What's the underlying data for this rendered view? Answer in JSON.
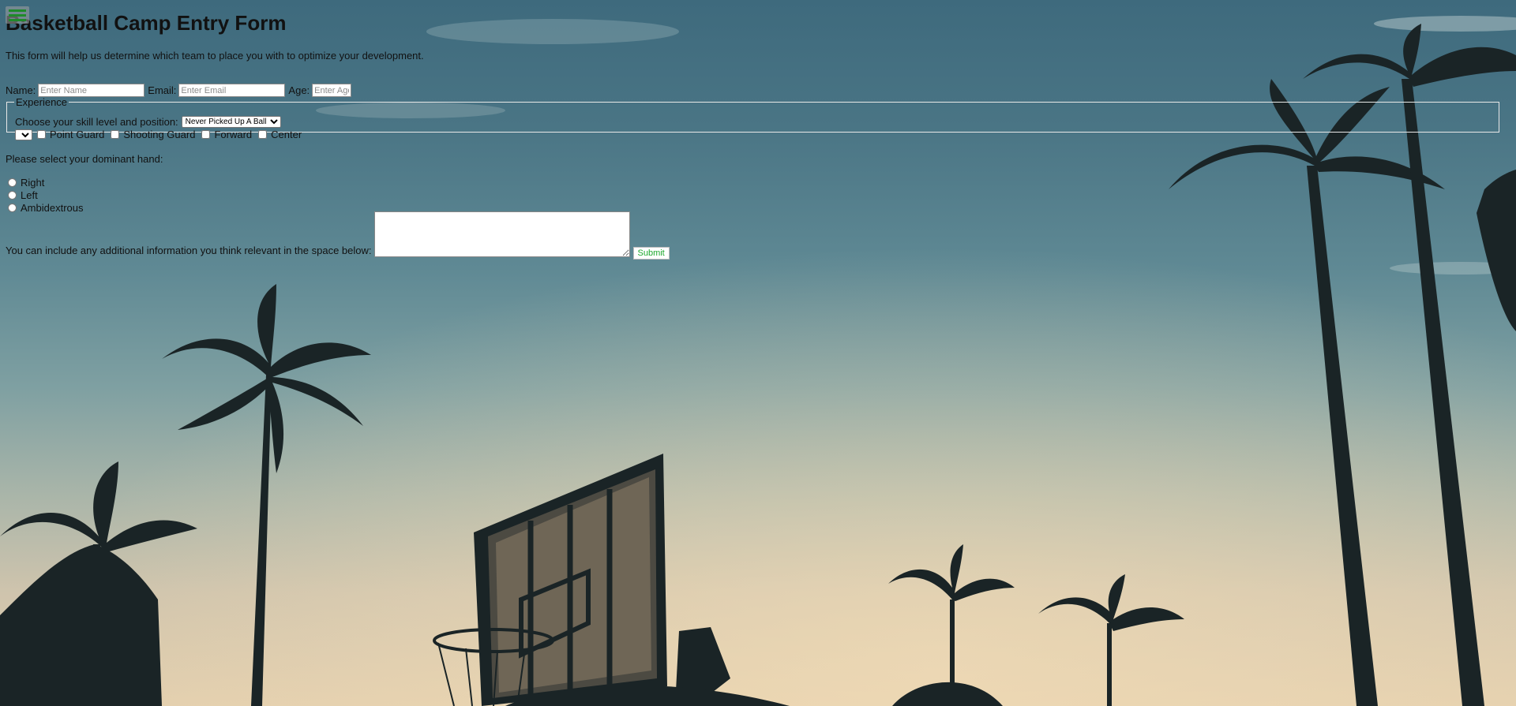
{
  "menu": {
    "icon": "hamburger-menu-icon",
    "icon_color": "#1f8a2b"
  },
  "form": {
    "title": "Basketball Camp Entry Form",
    "intro": "This form will help us determine which team to place you with to optimize your development.",
    "name_label": "Name:",
    "name_placeholder": "Enter Name",
    "email_label": "Email:",
    "email_placeholder": "Enter Email",
    "age_label": "Age:",
    "age_placeholder": "Enter Age"
  },
  "experience": {
    "legend": "Experience",
    "prompt": "Choose your skill level and position:",
    "skill_selected": "Never Picked Up A Ball",
    "positions": [
      "Point Guard",
      "Shooting Guard",
      "Forward",
      "Center"
    ]
  },
  "hand": {
    "question": "Please select your dominant hand:",
    "options": [
      "Right",
      "Left",
      "Ambidextrous"
    ]
  },
  "extra": {
    "label": "You can include any additional information you think relevant in the space below:",
    "submit_label": "Submit",
    "submit_color": "#1ea82d"
  },
  "background": {
    "scene": "sunset sky with palm trees and basketball hoop silhouette"
  }
}
